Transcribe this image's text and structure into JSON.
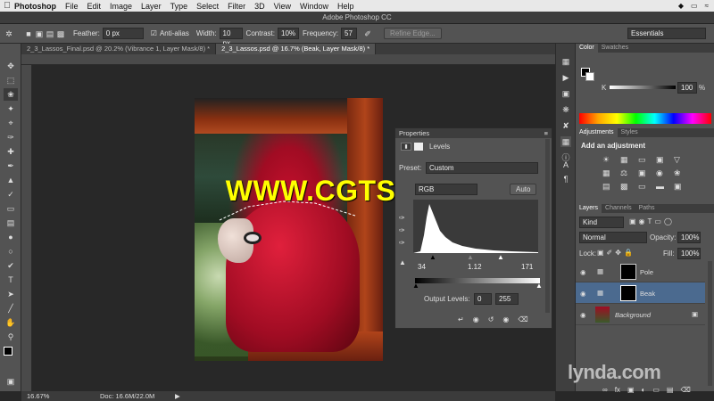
{
  "menubar": {
    "app": "Photoshop",
    "items": [
      "File",
      "Edit",
      "Image",
      "Layer",
      "Type",
      "Select",
      "Filter",
      "3D",
      "View",
      "Window",
      "Help"
    ]
  },
  "window_title": "Adobe Photoshop CC",
  "options": {
    "feather_label": "Feather:",
    "feather_value": "0 px",
    "antialias_label": "Anti-alias",
    "width_label": "Width:",
    "width_value": "10 px",
    "contrast_label": "Contrast:",
    "contrast_value": "10%",
    "frequency_label": "Frequency:",
    "frequency_value": "57",
    "refine_edge": "Refine Edge...",
    "workspace": "Essentials"
  },
  "tabs": [
    {
      "label": "2_3_Lassos_Final.psd @ 20.2% (Vibrance 1, Layer Mask/8) *",
      "active": false
    },
    {
      "label": "2_3_Lassos.psd @ 16.7% (Beak, Layer Mask/8) *",
      "active": true
    }
  ],
  "watermark": "WWW.CGTSJ.COM",
  "properties": {
    "title": "Properties",
    "panel": "Levels",
    "preset_label": "Preset:",
    "preset_value": "Custom",
    "channel": "RGB",
    "auto": "Auto",
    "input_black": "34",
    "input_gamma": "1.12",
    "input_white": "171",
    "output_label": "Output Levels:",
    "output_black": "0",
    "output_white": "255"
  },
  "color_panel": {
    "tabs": [
      "Color",
      "Swatches"
    ],
    "k_label": "K",
    "k_value": "100",
    "pct": "%"
  },
  "adjustments": {
    "tabs": [
      "Adjustments",
      "Styles"
    ],
    "title": "Add an adjustment"
  },
  "layers": {
    "tabs": [
      "Layers",
      "Channels",
      "Paths"
    ],
    "kind": "Kind",
    "blend": "Normal",
    "opacity_label": "Opacity:",
    "opacity_value": "100%",
    "lock_label": "Lock:",
    "fill_label": "Fill:",
    "fill_value": "100%",
    "rows": [
      {
        "name": "Pole",
        "selected": false
      },
      {
        "name": "Beak",
        "selected": true
      },
      {
        "name": "Background",
        "selected": false
      }
    ]
  },
  "status": {
    "zoom": "16.67%",
    "doc": "Doc: 16.6M/22.0M"
  },
  "brand": "lynda.com",
  "colors": {
    "selection": "#4b6a8f",
    "watermark": "#ffff00"
  }
}
